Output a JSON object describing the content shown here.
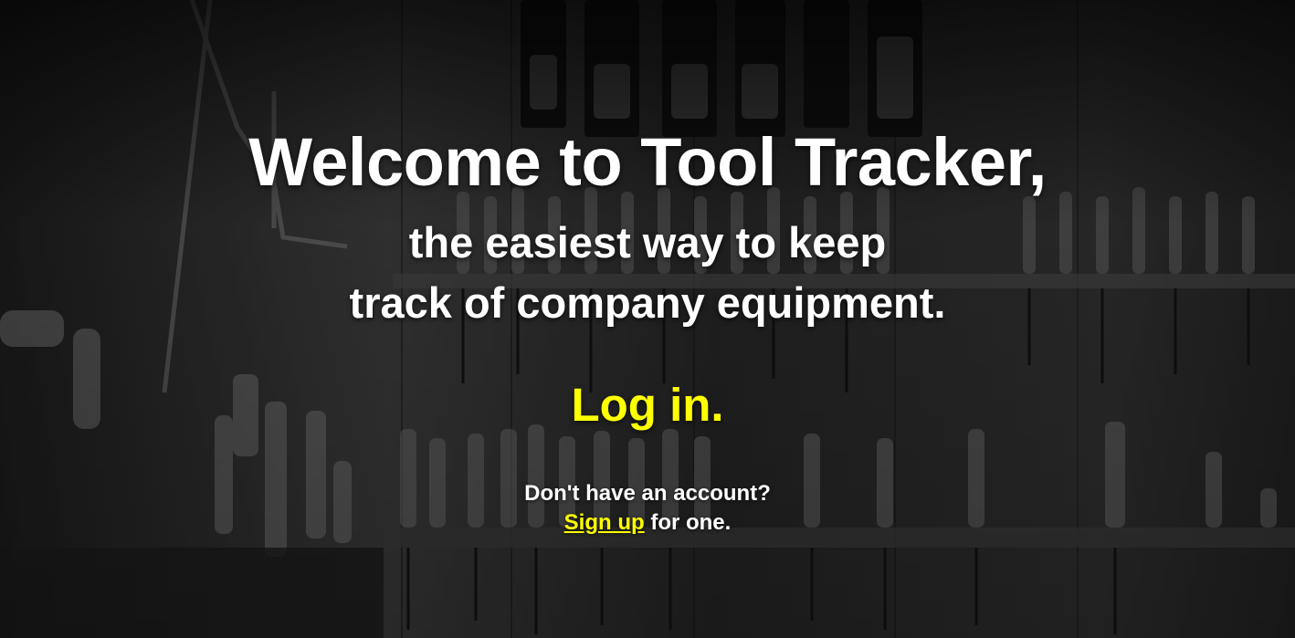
{
  "theme": {
    "accent": "#ffff00",
    "text": "#ffffff"
  },
  "hero": {
    "background": "workshop-tools-photo",
    "headline": "Welcome to Tool Tracker,",
    "subline_1": "the easiest way to keep",
    "subline_2": "track of company equipment."
  },
  "login": {
    "label": "Log in."
  },
  "signup": {
    "prompt": "Don't have an account?",
    "link_label": "Sign up",
    "suffix": "for one."
  }
}
